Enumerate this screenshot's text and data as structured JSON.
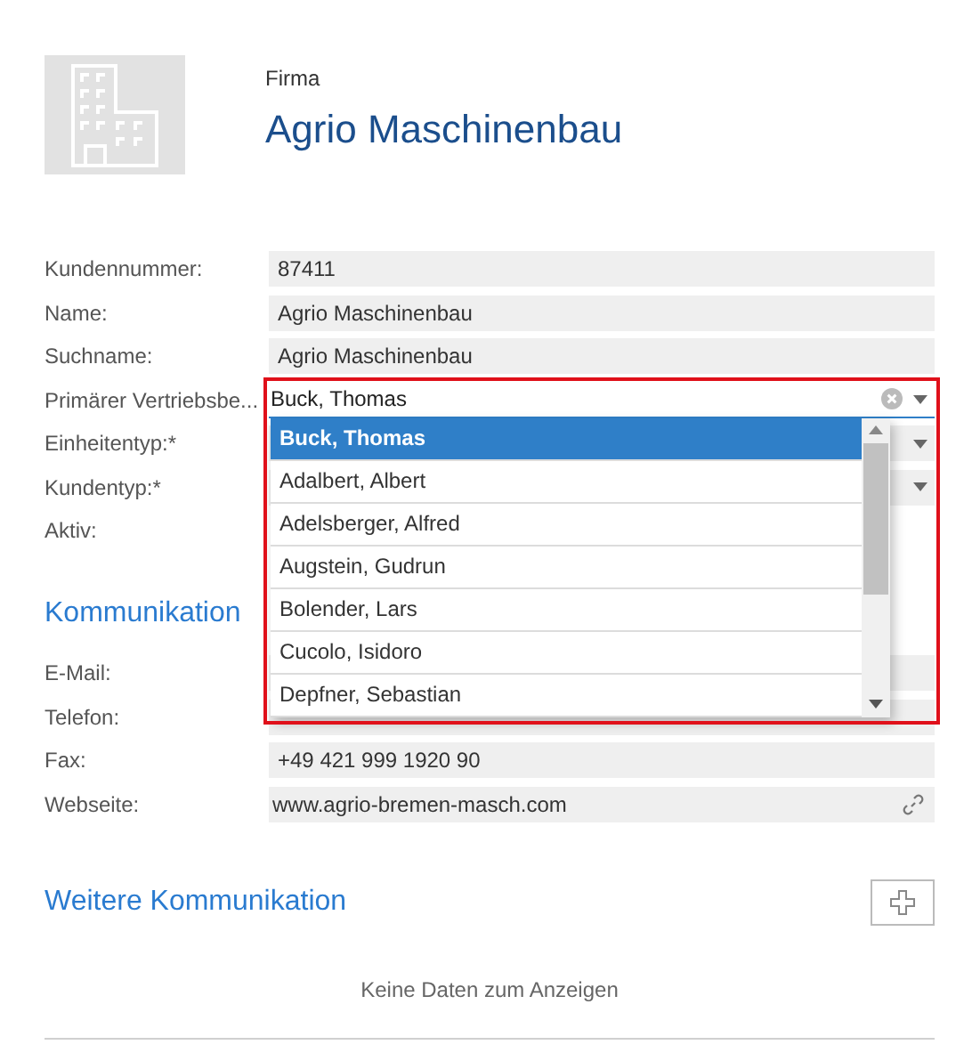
{
  "header": {
    "kind_label": "Firma",
    "title": "Agrio Maschinenbau"
  },
  "fields": [
    {
      "label": "Kundennummer:",
      "kind": "text",
      "value": "87411"
    },
    {
      "label": "Name:",
      "kind": "text",
      "value": "Agrio Maschinenbau"
    },
    {
      "label": "Suchname:",
      "kind": "text",
      "value": "Agrio Maschinenbau"
    },
    {
      "label": "Primärer Vertriebsbe...",
      "kind": "combo",
      "value": "Buck, Thomas",
      "expanded": true
    },
    {
      "label": "Einheitentyp:*",
      "kind": "select"
    },
    {
      "label": "Kundentyp:*",
      "kind": "select"
    },
    {
      "label": "Aktiv:",
      "kind": "blank"
    }
  ],
  "dropdown_options": [
    {
      "label": "Buck, Thomas",
      "selected": true
    },
    {
      "label": "Adalbert, Albert",
      "selected": false
    },
    {
      "label": "Adelsberger, Alfred",
      "selected": false
    },
    {
      "label": "Augstein, Gudrun",
      "selected": false
    },
    {
      "label": "Bolender, Lars",
      "selected": false
    },
    {
      "label": "Cucolo, Isidoro",
      "selected": false
    },
    {
      "label": "Depfner, Sebastian",
      "selected": false
    }
  ],
  "communication": {
    "title": "Kommunikation",
    "fields": [
      {
        "label": "E-Mail:",
        "kind": "text"
      },
      {
        "label": "Telefon:",
        "kind": "text"
      },
      {
        "label": "Fax:",
        "kind": "text",
        "value": "+49 421 999 1920 90"
      },
      {
        "label": "Webseite:",
        "kind": "link",
        "value": "www.agrio-bremen-masch.com"
      }
    ]
  },
  "more_communication": {
    "title": "Weitere Kommunikation",
    "empty_text": "Keine Daten zum Anzeigen"
  }
}
